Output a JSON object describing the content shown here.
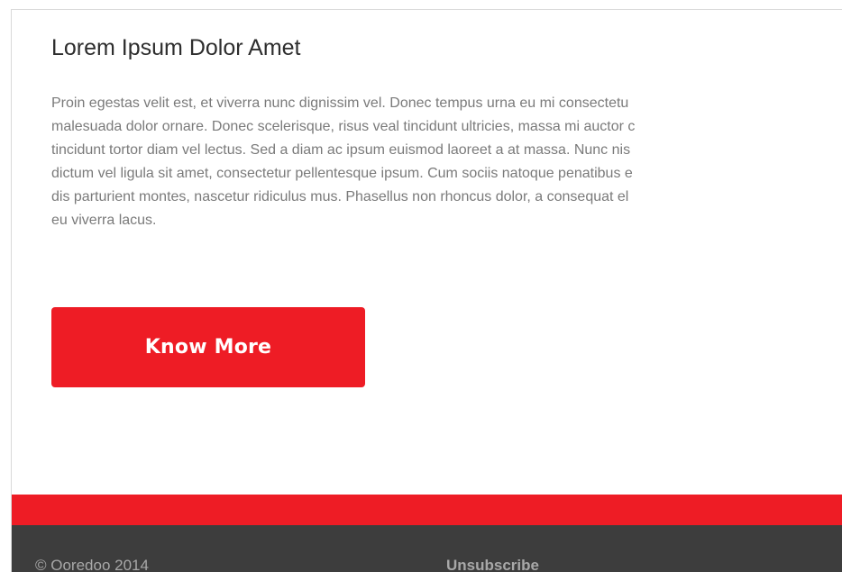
{
  "article": {
    "title": "Lorem Ipsum Dolor Amet",
    "lines": [
      "Proin egestas velit est, et viverra nunc dignissim vel. Donec tempus urna eu mi consectetu",
      "malesuada dolor ornare. Donec scelerisque, risus veal tincidunt ultricies, massa mi auctor c",
      "tincidunt tortor diam vel lectus. Sed a diam ac ipsum euismod laoreet a at massa. Nunc nis",
      "dictum vel ligula sit amet, consectetur pellentesque ipsum. Cum sociis natoque penatibus e",
      "dis parturient montes, nascetur ridiculus mus. Phasellus non rhoncus dolor, a consequat el",
      "eu viverra lacus."
    ],
    "button_label": "Know More"
  },
  "footer": {
    "copyright": "© Ooredoo 2014",
    "unsubscribe": "Unsubscribe"
  },
  "colors": {
    "brand_red": "#ee1c25",
    "footer_bg": "#3d3d3d",
    "footer_text": "#a8a8a8"
  }
}
